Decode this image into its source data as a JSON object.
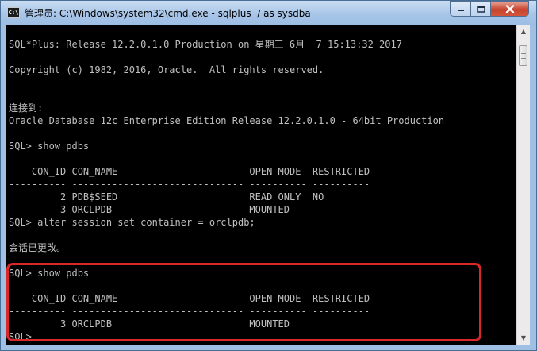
{
  "window": {
    "title": "管理员: C:\\Windows\\system32\\cmd.exe - sqlplus  / as sysdba",
    "icon_label": "C:\\"
  },
  "controls": {
    "minimize": "minimize-icon",
    "maximize": "maximize-icon",
    "close": "close-icon"
  },
  "console": {
    "lines": [
      "SQL*Plus: Release 12.2.0.1.0 Production on 星期三 6月  7 15:13:32 2017",
      "Copyright (c) 1982, 2016, Oracle.  All rights reserved.",
      "连接到:",
      "Oracle Database 12c Enterprise Edition Release 12.2.0.1.0 - 64bit Production",
      "SQL> show pdbs",
      "    CON_ID CON_NAME                       OPEN MODE  RESTRICTED",
      "---------- ------------------------------ ---------- ----------",
      "         2 PDB$SEED                       READ ONLY  NO",
      "         3 ORCLPDB                        MOUNTED",
      "SQL> alter session set container = orclpdb;",
      "会话已更改。",
      "SQL> show pdbs",
      "    CON_ID CON_NAME                       OPEN MODE  RESTRICTED",
      "---------- ------------------------------ ---------- ----------",
      "         3 ORCLPDB                        MOUNTED",
      "SQL>"
    ]
  },
  "colors": {
    "console_bg": "#000000",
    "console_text": "#c0c0c0",
    "highlight_border": "#d8282a",
    "titlebar": "#a9c6e8"
  }
}
